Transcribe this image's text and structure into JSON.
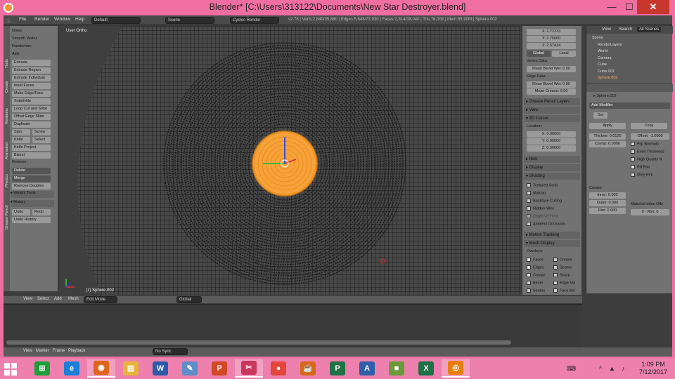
{
  "window": {
    "title": "Blender* [C:\\Users\\313122\\Documents\\New Star Destroyer.blend]",
    "minimize": "—",
    "maximize": "☐",
    "close": "✕"
  },
  "info_header": {
    "menus": [
      "File",
      "Render",
      "Window",
      "Help"
    ],
    "layout": "Default",
    "scene": "Scene",
    "engine": "Cycles Render",
    "stats": "v2.78 | Verts:2,840/35,880 | Edges:5,648/73,930 | Faces:2,814/38,040 | Tris:76,008 | Mem:55.90M | Sphere.002"
  },
  "toolshelf": {
    "tabs": [
      "Tools",
      "Create",
      "Relations",
      "Animation",
      "Physics",
      "Grease Pencil"
    ],
    "items": [
      {
        "t": "lbl",
        "text": "Noise"
      },
      {
        "t": "lbl",
        "text": "Smooth Vertex"
      },
      {
        "t": "lbl",
        "text": "Randomize"
      },
      {
        "t": "hdr",
        "text": "Add:"
      },
      {
        "t": "btn",
        "text": "Extrude"
      },
      {
        "t": "btn",
        "text": "Extrude Region"
      },
      {
        "t": "btn",
        "text": "Extrude Individual"
      },
      {
        "t": "btn",
        "text": "Inset Faces"
      },
      {
        "t": "btn",
        "text": "Make Edge/Face"
      },
      {
        "t": "btn",
        "text": "Subdivide"
      },
      {
        "t": "btn",
        "text": "Loop Cut and Slide"
      },
      {
        "t": "btn",
        "text": "Offset Edge Slide"
      },
      {
        "t": "btn",
        "text": "Duplicate"
      },
      {
        "t": "btn2",
        "text": [
          "Spin",
          "Screw"
        ]
      },
      {
        "t": "btn2",
        "text": [
          "Knife",
          "Select"
        ]
      },
      {
        "t": "btn",
        "text": "Knife Project"
      },
      {
        "t": "btn",
        "text": "Bisect"
      },
      {
        "t": "hdr",
        "text": "Remove:"
      },
      {
        "t": "dark",
        "text": "Delete"
      },
      {
        "t": "dark",
        "text": "Merge"
      },
      {
        "t": "btn",
        "text": "Remove Doubles"
      },
      {
        "t": "sec",
        "text": "▸ Weight Tools"
      },
      {
        "t": "sec",
        "text": "▾ History"
      },
      {
        "t": "btn2",
        "text": [
          "Undo",
          "Redo"
        ]
      },
      {
        "t": "btn",
        "text": "Undo History"
      }
    ]
  },
  "viewport": {
    "view_label": "User Ortho",
    "object_label": "(1) Sphere.002"
  },
  "viewport_header": {
    "items": [
      "View",
      "Select",
      "Add",
      "Mesh"
    ],
    "mode": "Edit Mode",
    "orientation": "Global"
  },
  "npanel": {
    "fields": [
      "X: 2.72233",
      "Y: 2.75000",
      "Z: 2.67414"
    ],
    "toggle": [
      "Global",
      "Local"
    ],
    "vertex_data": "Vertex Data:",
    "mean_bevel": "Mean Bevel Wei: 0.00",
    "edge_data": "Edge Data:",
    "edge_bevel": "Mean Bevel Wei: 0.00",
    "edge_crease": "Mean Crease: 0.00",
    "sections": [
      "▸ Grease Pencil Layers",
      "▸ View",
      "▾ 3D Cursor"
    ],
    "location": "Location:",
    "cursor": [
      "X: 0.00000",
      "Y: 0.00000",
      "Z: 0.00000"
    ],
    "sections2": [
      "▸ Item",
      "▸ Display",
      "▾ Shading"
    ],
    "shading": [
      "Textured Solid",
      "Matcap",
      "Backface Culling",
      "Hidden Wire",
      "Depth Of Field",
      "Ambient Occlusion"
    ],
    "sections3": [
      "▸ Motion Tracking",
      "▾ Mesh Display"
    ],
    "overlays": "Overlays:",
    "mesh_display": [
      [
        "Faces",
        "Crease"
      ],
      [
        "Edges",
        "Seams"
      ],
      [
        "Crease",
        "Sharp"
      ],
      [
        "Bevel",
        "Edge Ma"
      ],
      [
        "Seams",
        "Face Ma"
      ]
    ]
  },
  "outliner": {
    "header": [
      "View",
      "Search",
      "All Scenes"
    ],
    "items": [
      "Scene",
      "RenderLayers",
      "World",
      "Camera",
      "Cube",
      "Cube.001",
      "Sphere.002"
    ]
  },
  "properties": {
    "object": "Sphere.002",
    "add_modifier": "Add Modifier",
    "modifier": "Sol",
    "buttons": [
      "Apply",
      "Copy"
    ],
    "thickness": "Thickne: 0.0120",
    "offset": "Offset: -1.0000",
    "clamp": "Clamp: 0.0000",
    "checks": [
      "Flip Normals",
      "Even Thickness",
      "High Quality N",
      "Fill Rim",
      "Only Rim"
    ],
    "crease": "Crease:",
    "inner": "Inner: 0.000",
    "outer": "Outer: 0.000",
    "rim": "Rim: 0.000",
    "mat_index": "Material Index Offs",
    "mat_fields": [
      "0",
      "Rim: 0"
    ]
  },
  "timeline_header": {
    "items": [
      "View",
      "Marker",
      "Frame",
      "Playback"
    ],
    "sync": "No Sync"
  },
  "taskbar": {
    "apps": [
      "Store",
      "Internet Explorer",
      "Firefox",
      "File Explorer",
      "Word",
      "Paint",
      "PowerPoint",
      "Snipping Tool",
      "Chrome",
      "Java",
      "Project",
      "Writer",
      "Minecraft",
      "Excel",
      "Blender"
    ],
    "time": "1:09 PM",
    "date": "7/12/2017"
  }
}
